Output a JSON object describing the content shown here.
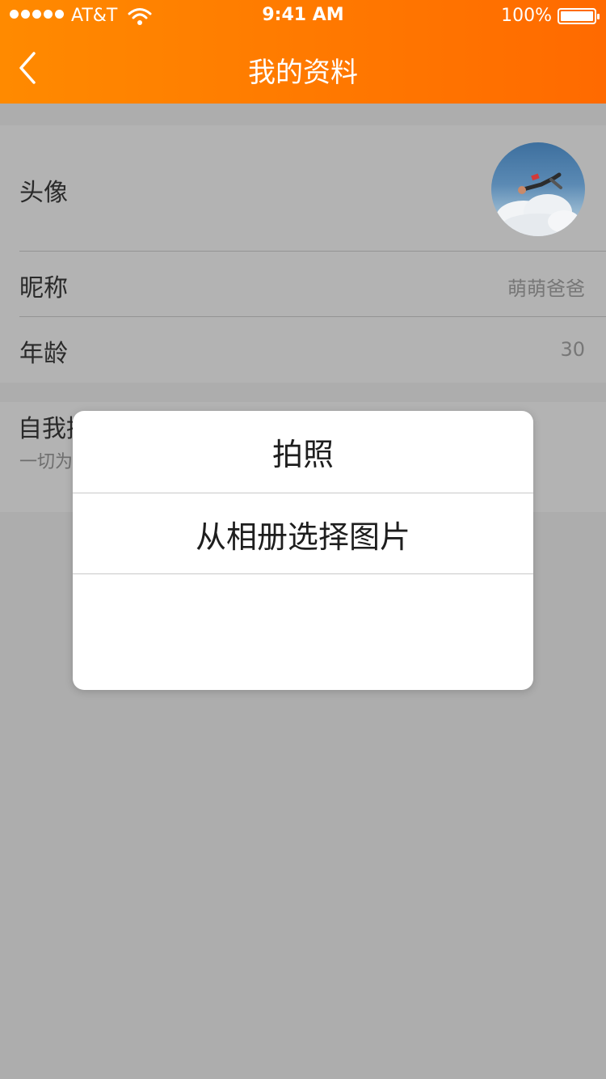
{
  "status_bar": {
    "carrier": "AT&T",
    "time": "9:41 AM",
    "battery": "100%",
    "battery_level": 1.0
  },
  "nav": {
    "title": "我的资料",
    "back_icon": "chevron-left-icon"
  },
  "profile": {
    "avatar_label": "头像",
    "nickname_label": "昵称",
    "nickname_value": "萌萌爸爸",
    "age_label": "年龄",
    "age_value": "30",
    "description_label": "自我描述",
    "description_text": "一切为"
  },
  "dialog": {
    "options": [
      "拍照",
      "从相册选择图片"
    ]
  },
  "colors": {
    "accent_start": "#ff8a00",
    "accent_end": "#ff6a00",
    "overlay": "#adadad"
  }
}
